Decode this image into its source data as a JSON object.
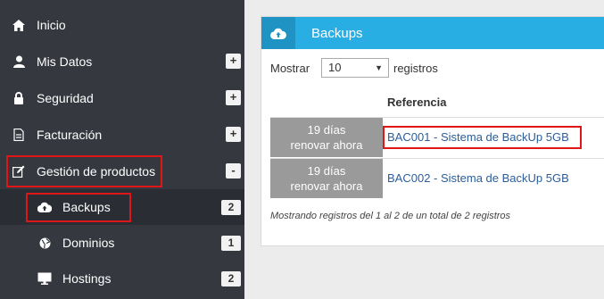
{
  "sidebar": {
    "items": [
      {
        "label": "Inicio",
        "icon": "home-icon"
      },
      {
        "label": "Mis Datos",
        "icon": "user-icon",
        "toggle": "+"
      },
      {
        "label": "Seguridad",
        "icon": "lock-icon",
        "toggle": "+"
      },
      {
        "label": "Facturación",
        "icon": "document-icon",
        "toggle": "+"
      },
      {
        "label": "Gestión de productos",
        "icon": "edit-icon",
        "toggle": "-"
      }
    ],
    "subitems": [
      {
        "label": "Backups",
        "icon": "cloud-upload-icon",
        "count": "2"
      },
      {
        "label": "Dominios",
        "icon": "globe-icon",
        "count": "1"
      },
      {
        "label": "Hostings",
        "icon": "monitor-icon",
        "count": "2"
      }
    ]
  },
  "panel": {
    "title": "Backups",
    "show_label": "Mostrar",
    "page_size": "10",
    "records_label": "registros",
    "column_header": "Referencia",
    "rows": [
      {
        "days": "19 días",
        "renew": "renovar ahora",
        "reference": "BAC001 - Sistema de BackUp 5GB"
      },
      {
        "days": "19 días",
        "renew": "renovar ahora",
        "reference": "BAC002 - Sistema de BackUp 5GB"
      }
    ],
    "footer": "Mostrando registros del 1 al 2 de un total de 2 registros"
  },
  "colors": {
    "sidebar_bg": "#35383f",
    "header_blue": "#29aee3",
    "highlight_red": "#e0151a",
    "days_cell_gray": "#9a9a9a",
    "link_blue": "#2b5e9a"
  }
}
